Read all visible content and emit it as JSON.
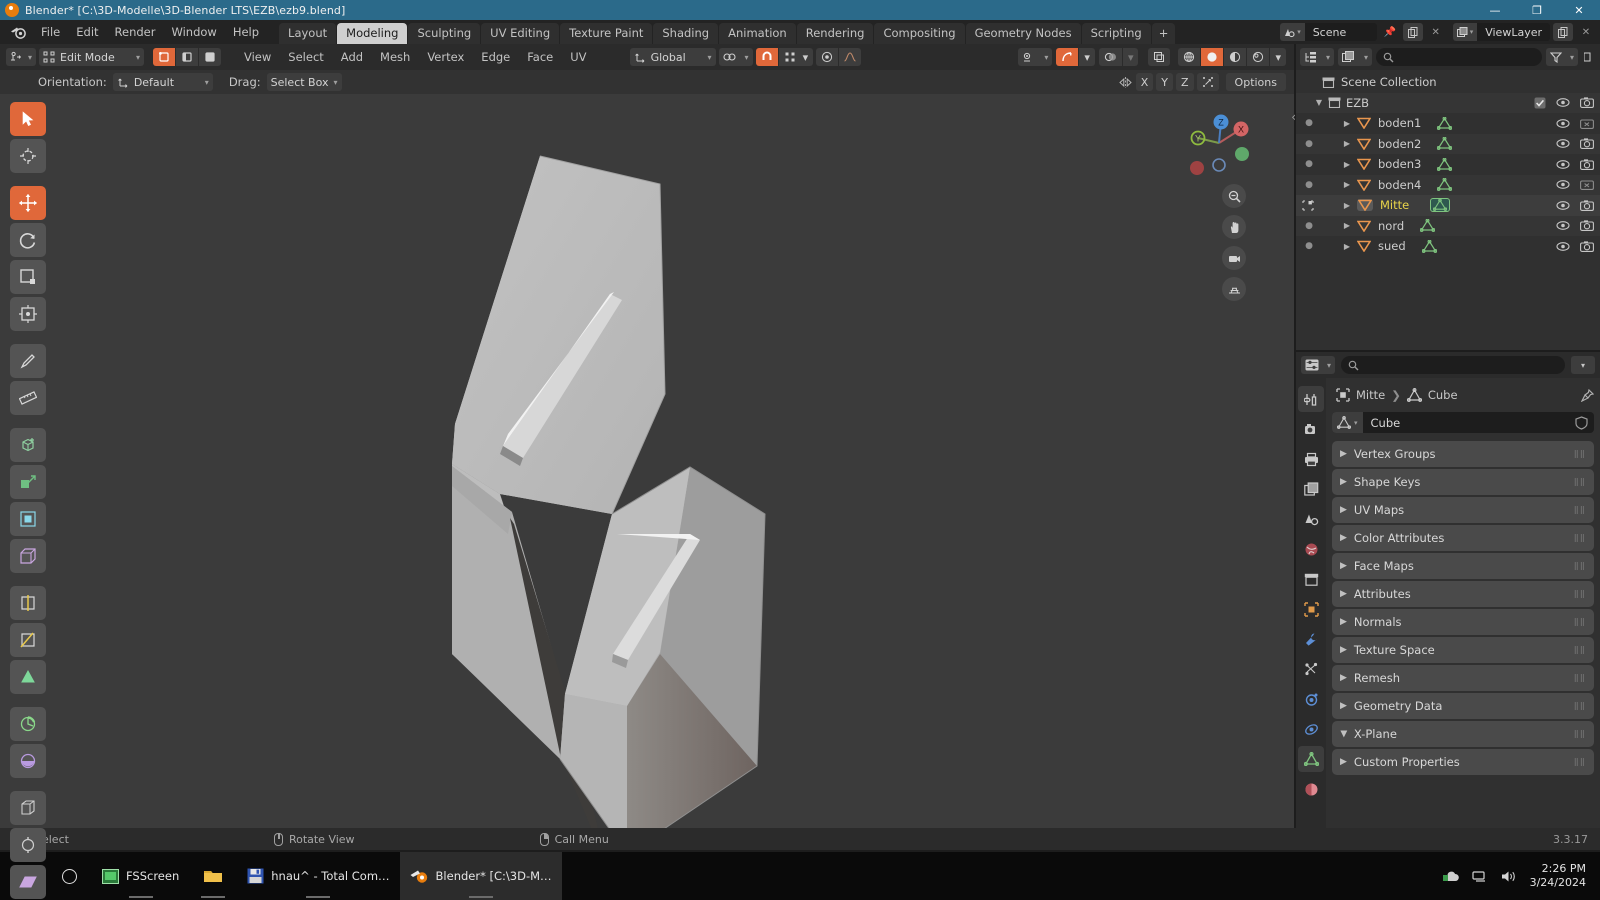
{
  "window": {
    "title": "Blender* [C:\\3D-Modelle\\3D-Blender LTS\\EZB\\ezb9.blend]",
    "minimize": "—",
    "maximize": "❐",
    "close": "✕"
  },
  "topbar": {
    "logo_icon": "blender-logo-icon",
    "menus": [
      "File",
      "Edit",
      "Render",
      "Window",
      "Help"
    ],
    "workspace_tabs": [
      {
        "label": "Layout",
        "active": false
      },
      {
        "label": "Modeling",
        "active": true
      },
      {
        "label": "Sculpting",
        "active": false
      },
      {
        "label": "UV Editing",
        "active": false
      },
      {
        "label": "Texture Paint",
        "active": false
      },
      {
        "label": "Shading",
        "active": false
      },
      {
        "label": "Animation",
        "active": false
      },
      {
        "label": "Rendering",
        "active": false
      },
      {
        "label": "Compositing",
        "active": false
      },
      {
        "label": "Geometry Nodes",
        "active": false
      },
      {
        "label": "Scripting",
        "active": false
      }
    ],
    "add_workspace_label": "+",
    "scene": {
      "value": "Scene",
      "pin_icon": "pin-icon",
      "copy_icon": "duplicate-icon",
      "delete_icon": "x-icon"
    },
    "viewlayer": {
      "value": "ViewLayer",
      "copy_icon": "duplicate-icon",
      "filter_icon": "filter-icon"
    }
  },
  "viewport_header": {
    "editor_type_icon": "editor-type-icon",
    "mode": "Edit Mode",
    "select_modes": [
      {
        "name": "vertex-select-mode",
        "active": true
      },
      {
        "name": "edge-select-mode",
        "active": false
      },
      {
        "name": "face-select-mode",
        "active": false
      }
    ],
    "menus": [
      "View",
      "Select",
      "Add",
      "Mesh",
      "Vertex",
      "Edge",
      "Face",
      "UV"
    ],
    "transform_orientation": "Global",
    "pivot_icon": "pivot-point-icon",
    "snap_magnet": {
      "name": "snap-magnet-toggle",
      "active": true
    },
    "snap_target_icon": "snap-target-icon",
    "proportional_edit": {
      "name": "proportional-editing-toggle",
      "active": false
    },
    "proportional_falloff_icon": "falloff-curve-icon",
    "right_tools": {
      "visibility_icon": "object-visibility-icon",
      "xray": {
        "name": "toggle-xray",
        "active": true
      },
      "overlays_icon": "overlays-icon",
      "gizmo_icon": "show-gizmo-icon",
      "shading_modes": [
        {
          "name": "wireframe-shading",
          "active": false
        },
        {
          "name": "solid-shading",
          "active": true
        },
        {
          "name": "material-preview-shading",
          "active": false
        },
        {
          "name": "rendered-shading",
          "active": false
        }
      ]
    }
  },
  "tool_settings": {
    "orientation_label": "Orientation:",
    "orientation_value": "Default",
    "drag_label": "Drag:",
    "drag_value": "Select Box",
    "mirror_icon": "mirror-icon",
    "axis_buttons": [
      "X",
      "Y",
      "Z"
    ],
    "mirror_uv_icon": "mirror-uv-icon",
    "options_label": "Options"
  },
  "toolbar": {
    "tools": [
      {
        "name": "tweak-tool",
        "icon": "cursor-arrow-icon",
        "active": true
      },
      {
        "name": "cursor-tool",
        "icon": "3d-cursor-icon",
        "active": false
      },
      {
        "name": "move-tool",
        "icon": "move-arrows-icon",
        "active": true
      },
      {
        "name": "rotate-tool",
        "icon": "rotate-icon",
        "active": false
      },
      {
        "name": "scale-tool",
        "icon": "scale-icon",
        "active": false
      },
      {
        "name": "transform-tool",
        "icon": "transform-icon",
        "active": false
      },
      {
        "name": "annotate-tool",
        "icon": "pencil-icon",
        "active": false
      },
      {
        "name": "measure-tool",
        "icon": "ruler-icon",
        "active": false
      },
      {
        "name": "add-cube-tool",
        "icon": "add-cube-icon",
        "active": false
      },
      {
        "name": "extrude-region-tool",
        "icon": "extrude-icon",
        "active": false
      },
      {
        "name": "inset-faces-tool",
        "icon": "inset-icon",
        "active": false
      },
      {
        "name": "bevel-tool",
        "icon": "bevel-icon",
        "active": false
      },
      {
        "name": "loop-cut-tool",
        "icon": "loop-cut-icon",
        "active": false
      },
      {
        "name": "knife-tool",
        "icon": "knife-icon",
        "active": false
      },
      {
        "name": "poly-build-tool",
        "icon": "poly-build-icon",
        "active": false
      },
      {
        "name": "spin-tool",
        "icon": "spin-icon",
        "active": false
      },
      {
        "name": "smooth-tool",
        "icon": "smooth-icon",
        "active": false
      },
      {
        "name": "edge-slide-tool",
        "icon": "edge-slide-icon",
        "active": false
      },
      {
        "name": "shrink-fatten-tool",
        "icon": "shrink-fatten-icon",
        "active": false
      },
      {
        "name": "shear-tool",
        "icon": "shear-icon",
        "active": false
      }
    ]
  },
  "gizmo": {
    "axes": [
      {
        "label": "X",
        "color": "#e05252",
        "filled": true
      },
      {
        "label": "Y",
        "color": "#8fbc3f",
        "filled": false
      },
      {
        "label": "Z",
        "color": "#4b8fd6",
        "filled": true
      }
    ],
    "buttons": [
      {
        "name": "zoom-view-button",
        "icon": "magnifier-icon"
      },
      {
        "name": "move-view-button",
        "icon": "hand-icon"
      },
      {
        "name": "camera-view-button",
        "icon": "camera-icon"
      },
      {
        "name": "toggle-perspective-button",
        "icon": "grid-perspective-icon"
      }
    ]
  },
  "outliner": {
    "display_mode_icon": "outliner-display-mode-icon",
    "filter_id_icon": "id-type-filter-icon",
    "search_placeholder": "",
    "filter_icon": "funnel-icon",
    "scene_collection": "Scene Collection",
    "collection": {
      "name": "EZB",
      "checkbox": true,
      "visible": true,
      "renderable": true
    },
    "objects": [
      {
        "name": "boden1",
        "selected": false,
        "visible": true,
        "renderable": false
      },
      {
        "name": "boden2",
        "selected": false,
        "visible": true,
        "renderable": true
      },
      {
        "name": "boden3",
        "selected": false,
        "visible": true,
        "renderable": true
      },
      {
        "name": "boden4",
        "selected": false,
        "visible": true,
        "renderable": false
      },
      {
        "name": "Mitte",
        "selected": true,
        "visible": true,
        "renderable": true
      },
      {
        "name": "nord",
        "selected": false,
        "visible": true,
        "renderable": true
      },
      {
        "name": "sued",
        "selected": false,
        "visible": true,
        "renderable": true
      }
    ]
  },
  "properties": {
    "editor_icon": "properties-editor-icon",
    "search_placeholder": "",
    "breadcrumb": [
      {
        "icon": "object-icon",
        "label": "Mitte"
      },
      {
        "icon": "mesh-data-icon",
        "label": "Cube"
      }
    ],
    "datablock_name": "Cube",
    "shield_icon": "fake-user-shield-icon",
    "tabs": [
      {
        "name": "tool-tab",
        "icon": "tool-icon",
        "active": false
      },
      {
        "name": "render-tab",
        "icon": "camera-back-icon",
        "active": false
      },
      {
        "name": "output-tab",
        "icon": "printer-icon",
        "active": false
      },
      {
        "name": "view-layer-tab",
        "icon": "images-icon",
        "active": false
      },
      {
        "name": "scene-tab",
        "icon": "scene-cone-icon",
        "active": false
      },
      {
        "name": "world-tab",
        "icon": "world-globe-icon",
        "active": false
      },
      {
        "name": "collection-tab",
        "icon": "collection-box-icon",
        "active": false
      },
      {
        "name": "object-tab",
        "icon": "object-square-icon",
        "active": false
      },
      {
        "name": "modifier-tab",
        "icon": "wrench-icon",
        "active": false
      },
      {
        "name": "particles-tab",
        "icon": "particles-icon",
        "active": false
      },
      {
        "name": "physics-tab",
        "icon": "physics-orbit-icon",
        "active": false
      },
      {
        "name": "constraints-tab",
        "icon": "constraint-icon",
        "active": false
      },
      {
        "name": "object-data-tab",
        "icon": "mesh-data-triangle-icon",
        "active": true
      },
      {
        "name": "material-tab",
        "icon": "material-sphere-icon",
        "active": false
      }
    ],
    "panels": [
      {
        "label": "Vertex Groups",
        "open": false
      },
      {
        "label": "Shape Keys",
        "open": false
      },
      {
        "label": "UV Maps",
        "open": false
      },
      {
        "label": "Color Attributes",
        "open": false
      },
      {
        "label": "Face Maps",
        "open": false
      },
      {
        "label": "Attributes",
        "open": false
      },
      {
        "label": "Normals",
        "open": false
      },
      {
        "label": "Texture Space",
        "open": false
      },
      {
        "label": "Remesh",
        "open": false
      },
      {
        "label": "Geometry Data",
        "open": false
      },
      {
        "label": "X-Plane",
        "open": true
      },
      {
        "label": "Custom Properties",
        "open": false
      }
    ]
  },
  "statusbar": {
    "items": [
      {
        "mouse": "left",
        "label": "Select"
      },
      {
        "mouse": "middle",
        "label": "Rotate View"
      },
      {
        "mouse": "right",
        "label": "Call Menu"
      }
    ],
    "version": "3.3.17"
  },
  "taskbar": {
    "start_icon": "windows-start-icon",
    "search_icon": "search-circle-icon",
    "buttons": [
      {
        "name": "taskbar-fsscreen",
        "label": "FSScreen",
        "icon": "fsscreen-icon",
        "active": false,
        "pinned": true
      },
      {
        "name": "taskbar-explorer",
        "label": "",
        "icon": "folder-icon",
        "active": false,
        "pinned": true
      },
      {
        "name": "taskbar-total-commander",
        "label": "hnau^ - Total Com…",
        "icon": "floppy-icon",
        "active": false,
        "pinned": true
      },
      {
        "name": "taskbar-blender",
        "label": "Blender* [C:\\3D-M…",
        "icon": "blender-icon",
        "active": true,
        "pinned": true
      }
    ],
    "tray": [
      {
        "name": "tray-onedrive-icon",
        "glyph": "☁"
      },
      {
        "name": "tray-network-icon",
        "glyph": "🖧"
      },
      {
        "name": "tray-volume-icon",
        "glyph": "🔊"
      }
    ],
    "clock_time": "2:26 PM",
    "clock_date": "3/24/2024"
  },
  "colors": {
    "accent": "#e0683a",
    "title_bar": "#2b6a8a",
    "viewport_bg": "#3b3b3b",
    "selected_text": "#e8d44a"
  }
}
